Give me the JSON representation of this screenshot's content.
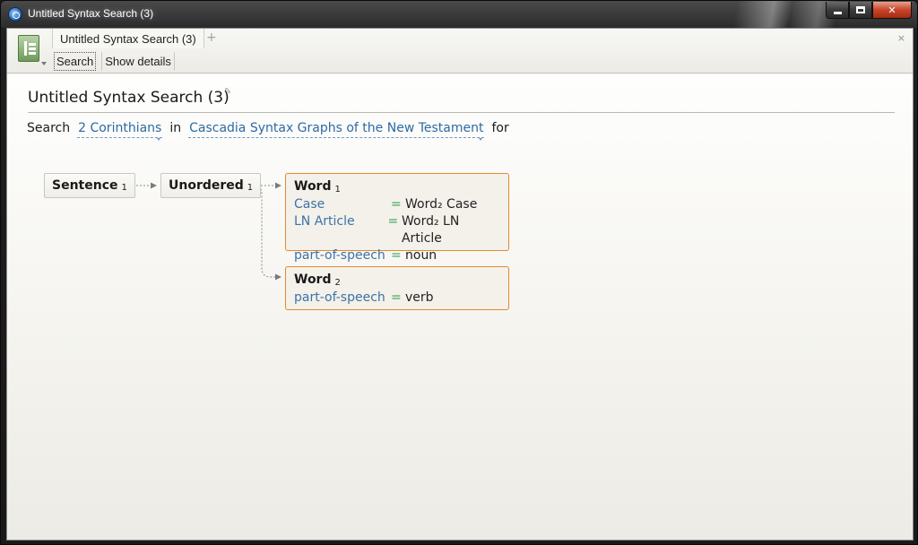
{
  "window": {
    "title": "Untitled Syntax Search (3)",
    "controls": {
      "minimize": "",
      "maximize": "",
      "close": "✕"
    }
  },
  "toolbar": {
    "tab_label": "Untitled Syntax Search (3)",
    "tab_add": "+",
    "tab_close": "×",
    "search_label": "Search",
    "details_label": "Show details"
  },
  "content": {
    "title": "Untitled Syntax Search (3)",
    "query": {
      "prefix": "Search",
      "range": "2 Corinthians",
      "in": "in",
      "resource": "Cascadia Syntax Graphs of the New Testament",
      "suffix": "for"
    }
  },
  "graph": {
    "sentence": {
      "label": "Sentence",
      "index": "1"
    },
    "unordered": {
      "label": "Unordered",
      "index": "1"
    },
    "word1": {
      "label": "Word",
      "index": "1",
      "attributes": [
        {
          "name": "Case",
          "op": "=",
          "value": "Word₂ Case"
        },
        {
          "name": "LN Article",
          "op": "=",
          "value": "Word₂ LN Article"
        },
        {
          "name": "part-of-speech",
          "op": "=",
          "value": "noun"
        }
      ]
    },
    "word2": {
      "label": "Word",
      "index": "2",
      "attributes": [
        {
          "name": "part-of-speech",
          "op": "=",
          "value": "verb"
        }
      ]
    }
  },
  "colors": {
    "link": "#2e6aa3",
    "attr_name": "#3d72a8",
    "operator": "#3aa05a",
    "word_border": "#e38a2e"
  }
}
